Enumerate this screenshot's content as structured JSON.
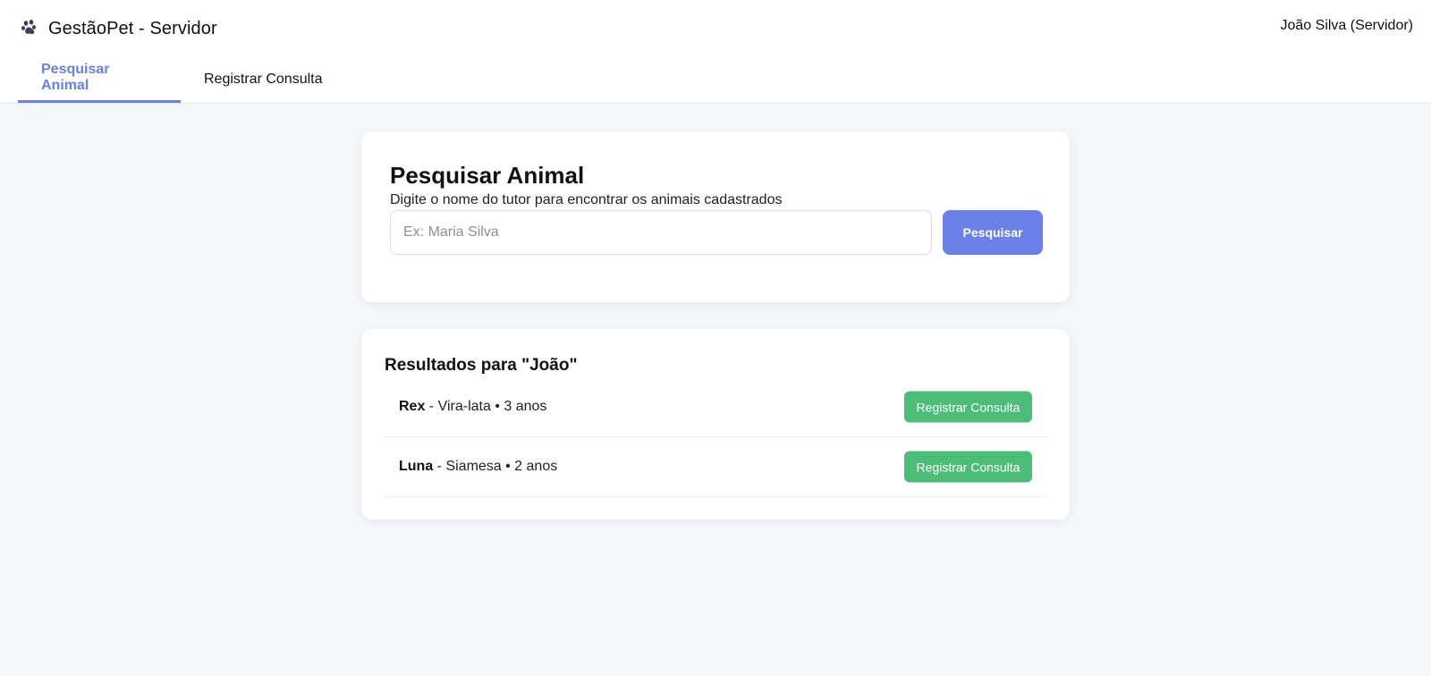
{
  "app": {
    "title": "GestãoPet - Servidor",
    "icon": "paw-icon",
    "user": "João Silva (Servidor)"
  },
  "tabs": [
    {
      "label": "Pesquisar Animal",
      "active": true
    },
    {
      "label": "Registrar Consulta",
      "active": false
    }
  ],
  "search": {
    "title": "Pesquisar Animal",
    "subtitle": "Digite o nome do tutor para encontrar os animais cadastrados",
    "placeholder": "Ex: Maria Silva",
    "value": "",
    "button_label": "Pesquisar"
  },
  "results": {
    "title": "Resultados para \"João\"",
    "items": [
      {
        "name": "Rex",
        "details": " - Vira-lata • 3 anos",
        "button_label": "Registrar Consulta"
      },
      {
        "name": "Luna",
        "details": " - Siamesa • 2 anos",
        "button_label": "Registrar Consulta"
      }
    ]
  },
  "colors": {
    "accent": "#6b80e8",
    "success": "#4cbd78",
    "background": "#f5f8fb"
  }
}
